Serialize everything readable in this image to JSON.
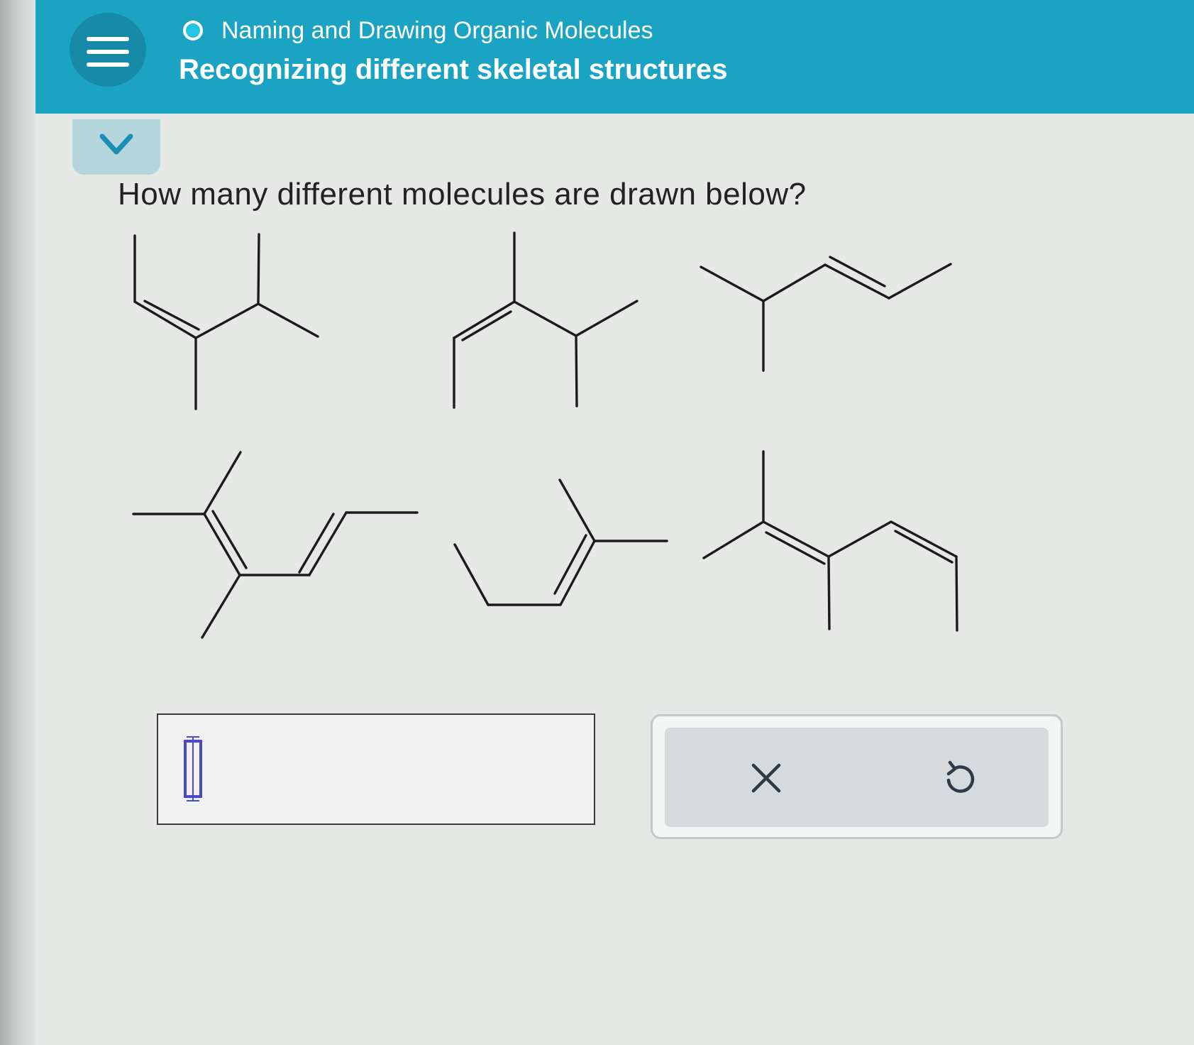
{
  "header": {
    "topic_title": "Naming and Drawing Organic Molecules",
    "page_title": "Recognizing different skeletal structures",
    "menu_icon": "hamburger-menu-icon",
    "topic_status_icon": "progress-circle-icon",
    "collapse_icon": "chevron-down-icon",
    "background_color": "#1ba3c4"
  },
  "question": {
    "text": "How many different molecules are drawn below?",
    "molecule_count_drawn": 6
  },
  "answer": {
    "value": "",
    "cursor_icon": "text-cursor-icon"
  },
  "actions": {
    "clear_icon": "close-x-icon",
    "undo_icon": "undo-icon"
  }
}
